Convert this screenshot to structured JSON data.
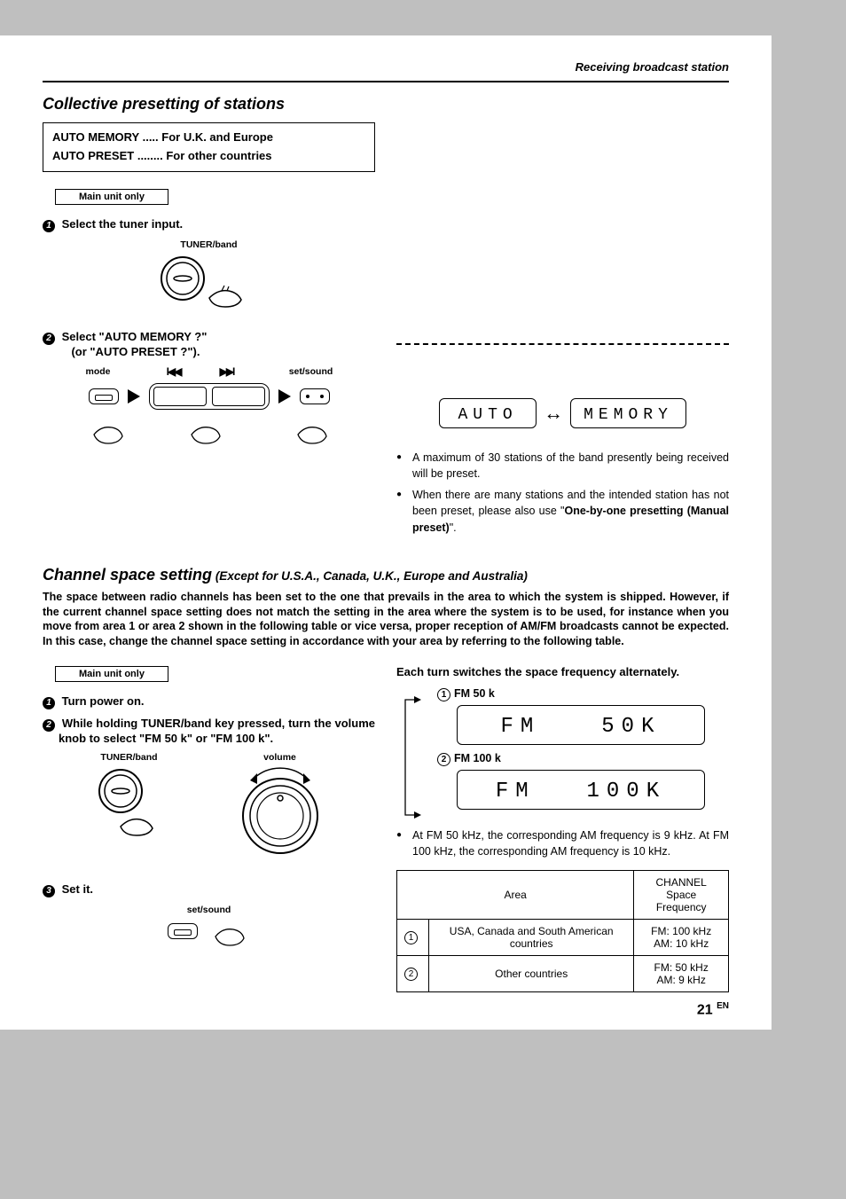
{
  "header": {
    "section": "Receiving broadcast station"
  },
  "sec1": {
    "title": "Collective presetting of stations",
    "box_line1": "AUTO MEMORY ..... For U.K. and Europe",
    "box_line2": "AUTO PRESET ........ For other countries",
    "unit_only": "Main unit only",
    "step1": "Select the tuner input.",
    "tuner_label": "TUNER/band",
    "step2a": "Select \"AUTO  MEMORY ?\"",
    "step2b": "(or \"AUTO PRESET ?\").",
    "mode_label": "mode",
    "skip_prev": "⏮",
    "skip_next": "⏭",
    "set_label": "set/sound",
    "lcd_auto": "AUTO",
    "lcd_memory": "MEMORY",
    "bullet1": "A maximum of 30 stations of the band presently being received will be preset.",
    "bullet2_a": "When there are many stations and the intended station has not been preset, please also use \"",
    "bullet2_b": "One-by-one presetting (Manual preset)",
    "bullet2_c": "\"."
  },
  "sec2": {
    "title": "Channel space setting",
    "subtitle": " (Except  for U.S.A., Canada, U.K., Europe and Australia)",
    "body": "The space between radio channels has been set to the one that prevails in the area to which the system is shipped. However, if the current channel space setting does not match the setting in the area where the system is to be used, for instance when you move from area 1 or area 2 shown in the following table or vice versa, proper reception of AM/FM broadcasts cannot be expected. In this case, change the channel space setting in accordance with your area by referring to the following table.",
    "unit_only": "Main unit only",
    "step1": "Turn power on.",
    "step2": "While holding TUNER/band key pressed, turn the volume knob to select \"FM 50 k\" or \"FM 100 k\".",
    "tuner_label": "TUNER/band",
    "vol_label": "volume",
    "step3": "Set it.",
    "set_label": "set/sound",
    "alt_label": "Each turn switches the space frequency alternately.",
    "fm50_label": "FM 50 k",
    "fm100_label": "FM 100 k",
    "lcd_fm": "FM",
    "lcd_50k": "50K",
    "lcd_100k": "100K",
    "bullet": "At FM 50 kHz, the corresponding AM frequency is 9 kHz. At FM 100 kHz, the corresponding AM frequency is 10 kHz.",
    "table": {
      "h1": "Area",
      "h2_a": "CHANNEL",
      "h2_b": "Space Frequency",
      "r1_area": "USA, Canada and South American countries",
      "r1_ch_a": "FM: 100 kHz",
      "r1_ch_b": "AM: 10 kHz",
      "r2_area": "Other countries",
      "r2_ch_a": "FM: 50 kHz",
      "r2_ch_b": "AM: 9 kHz"
    }
  },
  "footer": {
    "page": "21",
    "lang": "EN"
  }
}
